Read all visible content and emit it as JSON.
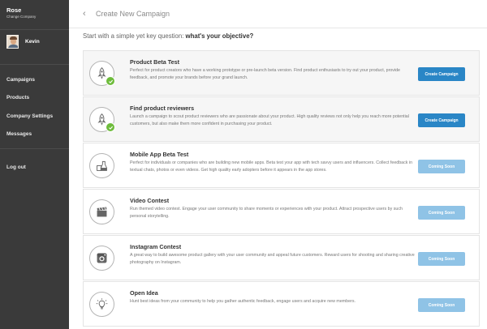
{
  "sidebar": {
    "company_name": "Rose",
    "change_company": "Change Company",
    "user_name": "Kevin",
    "nav": [
      "Campaigns",
      "Products",
      "Company Settings",
      "Messages"
    ],
    "logout": "Log out"
  },
  "header": {
    "back_icon": "‹",
    "title": "Create New Campaign"
  },
  "question": {
    "prefix": "Start with a simple yet key question: ",
    "bold": "what's your objective?"
  },
  "campaigns": [
    {
      "title": "Product Beta Test",
      "description": "Perfect for product creators who have a working prototype or pre-launch beta version. Find product enthusiasts to try out your product, provide feedback, and promote your brands before your grand launch.",
      "button": "Create Campaign",
      "icon": "rocket-icon",
      "checked": true
    },
    {
      "title": "Find product reviewers",
      "description": "Launch a campaign to scout product reviewers who are passionate about your product. High quality reviews not only help you reach more potential customers, but also make them more confident in purchasing your product.",
      "button": "Create Campaign",
      "icon": "rocket-icon",
      "checked": true
    },
    {
      "title": "Mobile App Beta Test",
      "description": "Perfect for individuals or companies who are building new mobile apps. Beta test your app with tech savvy users and influencers. Collect feedback in textual chats, photos or even videos. Get high quality early adopters before it appears in the app stores.",
      "button": "Coming Soon",
      "icon": "flask-icon",
      "checked": false
    },
    {
      "title": "Video Contest",
      "description": "Run themed video contest. Engage your user community to share moments or experiences with your product. Attract prospective users by such personal storytelling.",
      "button": "Coming Soon",
      "icon": "clapperboard-icon",
      "checked": false
    },
    {
      "title": "Instagram Contest",
      "description": "A great way to build awesome product gallery with your user community and appeal future customers. Reward users for shooting and sharing creative photography on Instagram.",
      "button": "Coming Soon",
      "icon": "camera-icon",
      "checked": false
    },
    {
      "title": "Open Idea",
      "description": "Hunt best ideas from your community to help you gather authentic feedback, engage users and acquire new members.",
      "button": "Coming Soon",
      "icon": "lightbulb-icon",
      "checked": false
    }
  ],
  "colors": {
    "sidebar_bg": "#3a3a3a",
    "create_button": "#2a86c6",
    "coming_soon_button": "#8fc3e6",
    "check_green": "#6ebc3c"
  }
}
